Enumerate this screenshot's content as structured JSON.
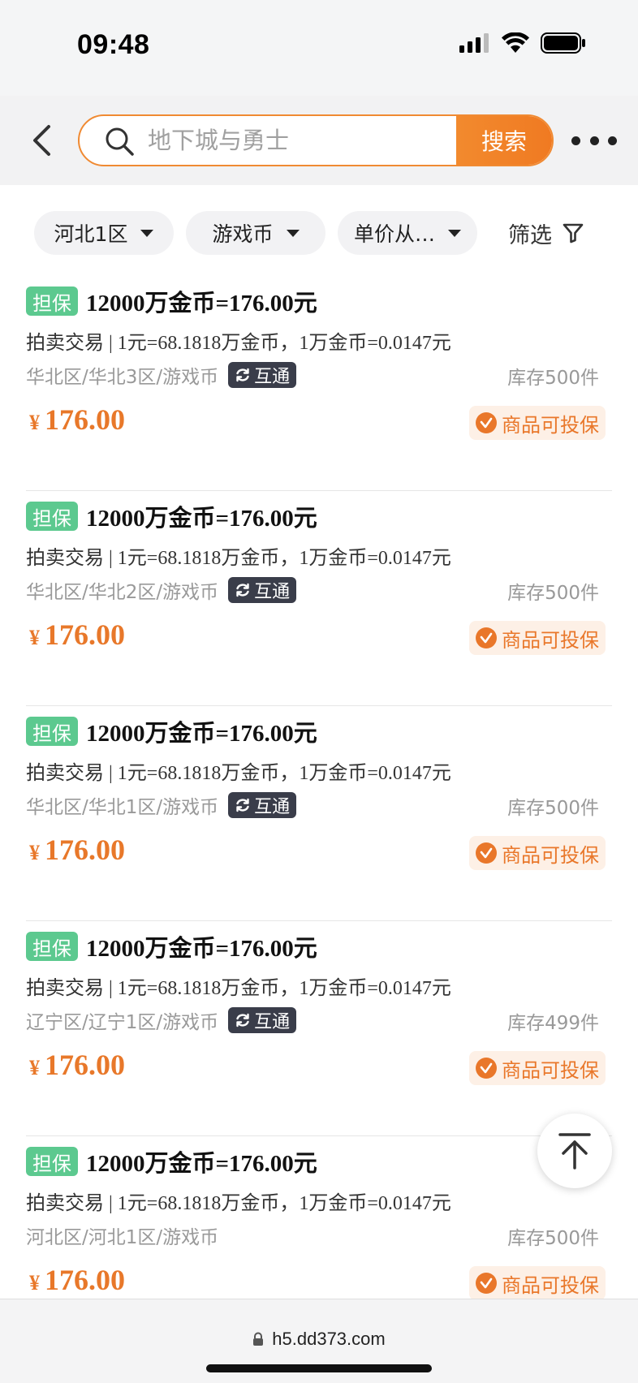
{
  "status_bar": {
    "time": "09:48"
  },
  "header": {
    "search_placeholder": "地下城与勇士",
    "search_button": "搜索"
  },
  "filters": {
    "region": "河北1区",
    "category": "游戏币",
    "sort": "单价从…",
    "filter": "筛选"
  },
  "colors": {
    "accent": "#f08a32",
    "price": "#e8782a",
    "guarantee_badge": "#5cc98f",
    "interop_badge": "#3a3d4a"
  },
  "listings": [
    {
      "badge": "担保",
      "title": "12000万金币=176.00元",
      "trade_type": "拍卖交易",
      "rate": "| 1元=68.1818万金币，1万金币=0.0147元",
      "server": "华北区/华北3区/游戏币",
      "interop": "互通",
      "stock": "库存500件",
      "currency": "¥",
      "price": "176.00",
      "insurance": "商品可投保"
    },
    {
      "badge": "担保",
      "title": "12000万金币=176.00元",
      "trade_type": "拍卖交易",
      "rate": "| 1元=68.1818万金币，1万金币=0.0147元",
      "server": "华北区/华北2区/游戏币",
      "interop": "互通",
      "stock": "库存500件",
      "currency": "¥",
      "price": "176.00",
      "insurance": "商品可投保"
    },
    {
      "badge": "担保",
      "title": "12000万金币=176.00元",
      "trade_type": "拍卖交易",
      "rate": "| 1元=68.1818万金币，1万金币=0.0147元",
      "server": "华北区/华北1区/游戏币",
      "interop": "互通",
      "stock": "库存500件",
      "currency": "¥",
      "price": "176.00",
      "insurance": "商品可投保"
    },
    {
      "badge": "担保",
      "title": "12000万金币=176.00元",
      "trade_type": "拍卖交易",
      "rate": "| 1元=68.1818万金币，1万金币=0.0147元",
      "server": "辽宁区/辽宁1区/游戏币",
      "interop": "互通",
      "stock": "库存499件",
      "currency": "¥",
      "price": "176.00",
      "insurance": "商品可投保"
    },
    {
      "badge": "担保",
      "title": "12000万金币=176.00元",
      "trade_type": "拍卖交易",
      "rate": "| 1元=68.1818万金币，1万金币=0.0147元",
      "server": "河北区/河北1区/游戏币",
      "interop": "",
      "stock": "库存500件",
      "currency": "¥",
      "price": "176.00",
      "insurance": "商品可投保"
    }
  ],
  "browser": {
    "url": "h5.dd373.com"
  }
}
